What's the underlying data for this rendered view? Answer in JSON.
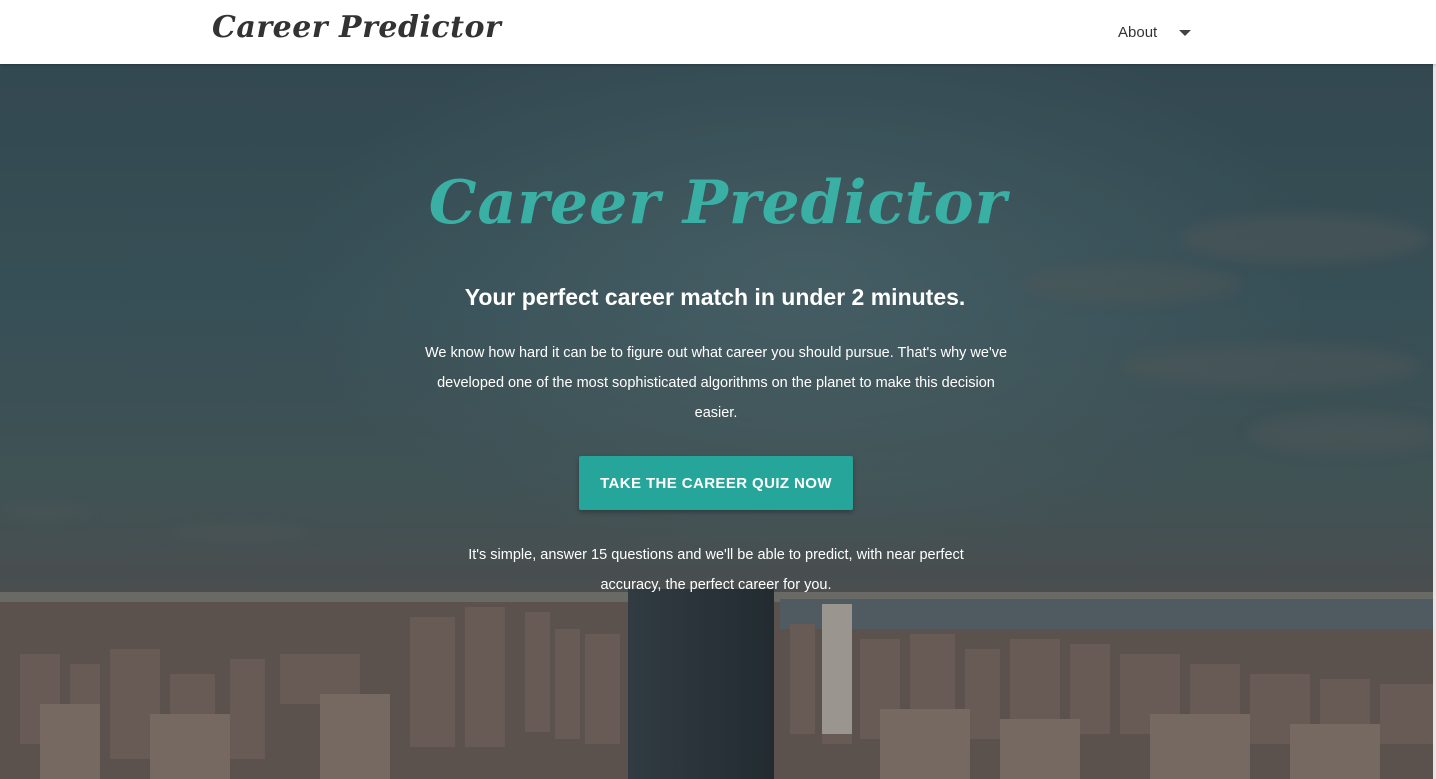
{
  "navbar": {
    "brand": "Career Predictor",
    "menu_label": "About",
    "menu_icon": "caret-down-icon"
  },
  "hero": {
    "title": "Career Predictor",
    "tagline": "Your perfect career match in under 2 minutes.",
    "intro": "We know how hard it can be to figure out what career you should pursue. That's why we've developed one of the most sophisticated algorithms on the planet to make this decision easier.",
    "cta_label": "TAKE THE CAREER QUIZ NOW",
    "footnote": "It's simple, answer 15 questions and we'll be able to predict, with near perfect accuracy, the perfect career for you.",
    "background_image": "city-skyline-photo"
  },
  "colors": {
    "accent": "#26a69a",
    "title": "#3ab0a4",
    "navbar_bg": "#ffffff",
    "text_light": "#ffffff"
  }
}
